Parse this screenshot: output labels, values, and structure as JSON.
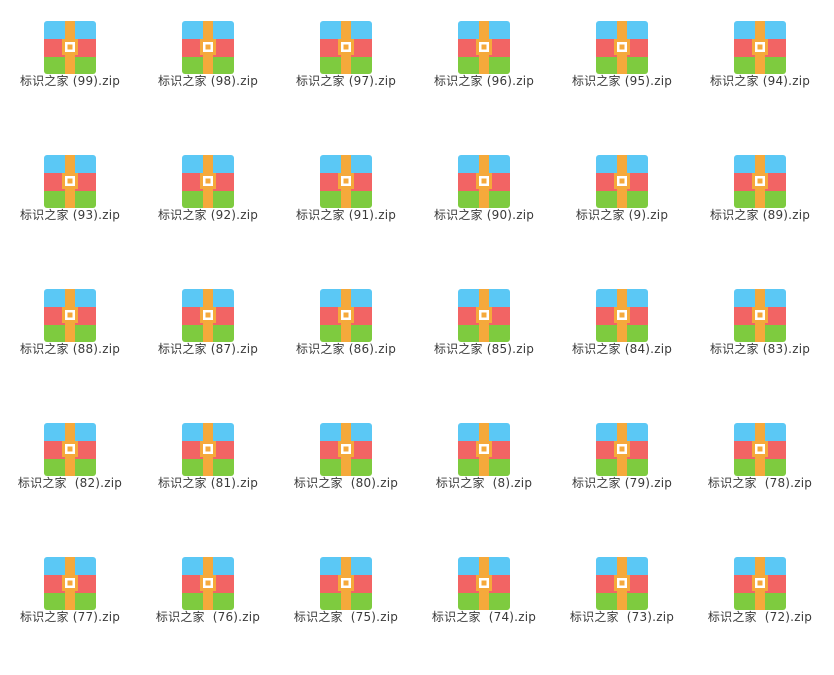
{
  "files": [
    {
      "name": "标识之家 (99).zip",
      "icon": "zip-archive-icon"
    },
    {
      "name": "标识之家 (98).zip",
      "icon": "zip-archive-icon"
    },
    {
      "name": "标识之家 (97).zip",
      "icon": "zip-archive-icon"
    },
    {
      "name": "标识之家 (96).zip",
      "icon": "zip-archive-icon"
    },
    {
      "name": "标识之家 (95).zip",
      "icon": "zip-archive-icon"
    },
    {
      "name": "标识之家 (94).zip",
      "icon": "zip-archive-icon"
    },
    {
      "name": "标识之家 (93).zip",
      "icon": "zip-archive-icon"
    },
    {
      "name": "标识之家 (92).zip",
      "icon": "zip-archive-icon"
    },
    {
      "name": "标识之家 (91).zip",
      "icon": "zip-archive-icon"
    },
    {
      "name": "标识之家 (90).zip",
      "icon": "zip-archive-icon"
    },
    {
      "name": "标识之家 (9).zip",
      "icon": "zip-archive-icon"
    },
    {
      "name": "标识之家 (89).zip",
      "icon": "zip-archive-icon"
    },
    {
      "name": "标识之家 (88).zip",
      "icon": "zip-archive-icon"
    },
    {
      "name": "标识之家 (87).zip",
      "icon": "zip-archive-icon"
    },
    {
      "name": "标识之家 (86).zip",
      "icon": "zip-archive-icon"
    },
    {
      "name": "标识之家 (85).zip",
      "icon": "zip-archive-icon"
    },
    {
      "name": "标识之家 (84).zip",
      "icon": "zip-archive-icon"
    },
    {
      "name": "标识之家 (83).zip",
      "icon": "zip-archive-icon"
    },
    {
      "name": "标识之家  (82).zip",
      "icon": "zip-archive-icon"
    },
    {
      "name": "标识之家 (81).zip",
      "icon": "zip-archive-icon"
    },
    {
      "name": "标识之家  (80).zip",
      "icon": "zip-archive-icon"
    },
    {
      "name": "标识之家  (8).zip",
      "icon": "zip-archive-icon"
    },
    {
      "name": "标识之家 (79).zip",
      "icon": "zip-archive-icon"
    },
    {
      "name": "标识之家  (78).zip",
      "icon": "zip-archive-icon"
    },
    {
      "name": "标识之家 (77).zip",
      "icon": "zip-archive-icon"
    },
    {
      "name": "标识之家  (76).zip",
      "icon": "zip-archive-icon"
    },
    {
      "name": "标识之家  (75).zip",
      "icon": "zip-archive-icon"
    },
    {
      "name": "标识之家  (74).zip",
      "icon": "zip-archive-icon"
    },
    {
      "name": "标识之家  (73).zip",
      "icon": "zip-archive-icon"
    },
    {
      "name": "标识之家  (72).zip",
      "icon": "zip-archive-icon"
    }
  ],
  "icon_colors": {
    "top": "#5bc8f5",
    "middle": "#f26464",
    "bottom": "#7ecb3f",
    "strap": "#f5a93b",
    "buckle_fill": "#ffffff"
  }
}
